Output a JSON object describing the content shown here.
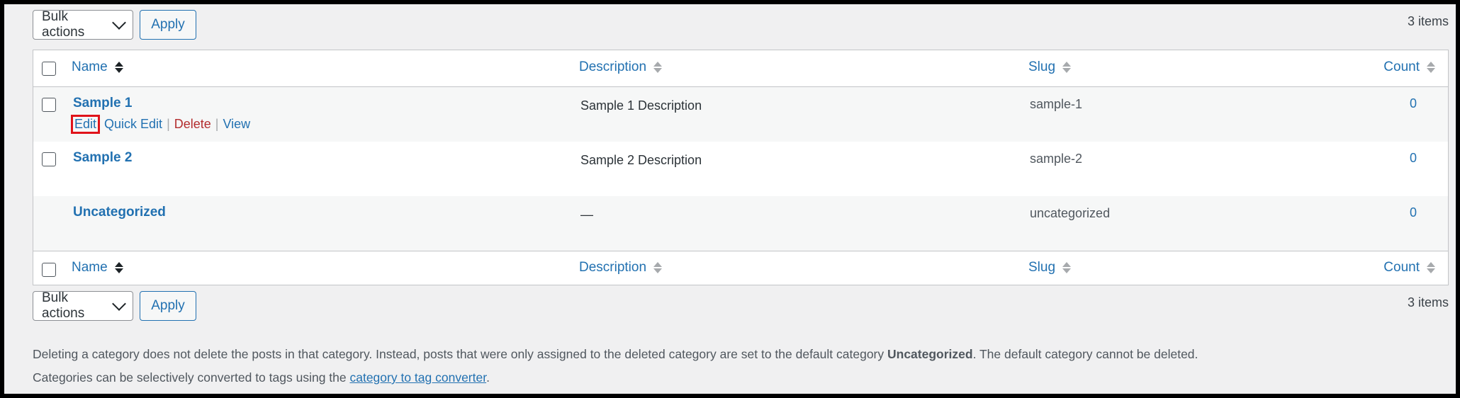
{
  "tablenav_top": {
    "bulk_label": "Bulk actions",
    "apply_label": "Apply",
    "count": "3 items"
  },
  "tablenav_bottom": {
    "bulk_label": "Bulk actions",
    "apply_label": "Apply",
    "count": "3 items"
  },
  "columns": {
    "name": "Name",
    "description": "Description",
    "slug": "Slug",
    "count": "Count"
  },
  "rows": [
    {
      "name": "Sample 1",
      "description": "Sample 1 Description",
      "slug": "sample-1",
      "count": "0",
      "actions": {
        "edit": "Edit",
        "quick_edit": "Quick Edit",
        "delete": "Delete",
        "view": "View"
      }
    },
    {
      "name": "Sample 2",
      "description": "Sample 2 Description",
      "slug": "sample-2",
      "count": "0"
    },
    {
      "name": "Uncategorized",
      "description": "—",
      "slug": "uncategorized",
      "count": "0"
    }
  ],
  "notes": {
    "line1_before": "Deleting a category does not delete the posts in that category. Instead, posts that were only assigned to the deleted category are set to the default category ",
    "line1_bold": "Uncategorized",
    "line1_after": ". The default category cannot be deleted.",
    "line2_before": "Categories can be selectively converted to tags using the ",
    "line2_link": "category to tag converter",
    "line2_after": "."
  },
  "colors": {
    "link": "#2271b1",
    "delete": "#b32d2e",
    "highlight_box": "#e0131a",
    "background": "#f0f0f1"
  },
  "icons": {
    "sort": "sort-arrows-icon",
    "dropdown": "chevron-down-icon"
  }
}
